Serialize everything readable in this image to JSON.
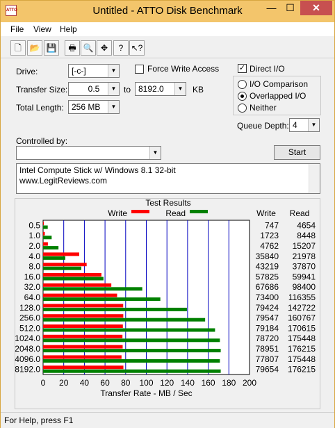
{
  "window": {
    "title": "Untitled - ATTO Disk Benchmark",
    "app_icon_text": "ATTO",
    "min_glyph": "—",
    "max_glyph": "☐",
    "close_glyph": "✕"
  },
  "menu": {
    "file": "File",
    "view": "View",
    "help": "Help"
  },
  "toolbar": {
    "buttons": [
      "new-icon",
      "open-icon",
      "save-icon",
      "print-icon",
      "print-preview-icon",
      "move-icon",
      "help-icon",
      "context-help-icon"
    ]
  },
  "settings": {
    "drive_label": "Drive:",
    "drive_value": "[-c-]",
    "force_write_label": "Force Write Access",
    "direct_io_label": "Direct I/O",
    "direct_io_checked": true,
    "transfer_size_label": "Transfer Size:",
    "transfer_from": "0.5",
    "to_label": "to",
    "transfer_to": "8192.0",
    "kb_label": "KB",
    "total_length_label": "Total Length:",
    "total_length_value": "256 MB",
    "io_comparison_label": "I/O Comparison",
    "overlapped_io_label": "Overlapped I/O",
    "neither_label": "Neither",
    "selected_mode": "overlapped",
    "queue_depth_label": "Queue Depth:",
    "queue_depth_value": "4",
    "controlled_by_label": "Controlled by:",
    "controlled_by_value": "",
    "start_label": "Start",
    "description_line1": "Intel Compute Stick w/ Windows 8.1 32-bit",
    "description_line2": "www.LegitReviews.com"
  },
  "results": {
    "title": "Test Results",
    "write_legend": "Write",
    "read_legend": "Read",
    "write_col": "Write",
    "read_col": "Read",
    "write_color": "#ff0000",
    "read_color": "#008000"
  },
  "status": {
    "text": "For Help, press F1"
  },
  "chart_data": {
    "type": "bar",
    "orientation": "horizontal",
    "title": "Test Results",
    "xlabel": "Transfer Rate - MB / Sec",
    "xlim": [
      0,
      200
    ],
    "xticks": [
      0,
      20,
      40,
      60,
      80,
      100,
      120,
      140,
      160,
      180,
      200
    ],
    "categories": [
      "0.5",
      "1.0",
      "2.0",
      "4.0",
      "8.0",
      "16.0",
      "32.0",
      "64.0",
      "128.0",
      "256.0",
      "512.0",
      "1024.0",
      "2048.0",
      "4096.0",
      "8192.0"
    ],
    "series": [
      {
        "name": "Write",
        "color": "#ff0000",
        "values": [
          0.73,
          1.68,
          4.65,
          35.0,
          42.2,
          56.5,
          66.1,
          71.7,
          77.6,
          77.7,
          77.3,
          76.9,
          77.1,
          76.0,
          77.8
        ],
        "labels": [
          "747",
          "1723",
          "4762",
          "35840",
          "43219",
          "57825",
          "67686",
          "73400",
          "79424",
          "79547",
          "79184",
          "78720",
          "78951",
          "77807",
          "79654"
        ]
      },
      {
        "name": "Read",
        "color": "#008000",
        "values": [
          4.5,
          8.3,
          14.9,
          21.5,
          37.0,
          58.5,
          96.1,
          113.6,
          139.4,
          157.0,
          166.6,
          171.3,
          172.1,
          171.3,
          172.1
        ],
        "labels": [
          "4654",
          "8448",
          "15207",
          "21978",
          "37870",
          "59941",
          "98400",
          "116355",
          "142722",
          "160767",
          "170615",
          "175448",
          "176215",
          "175448",
          "176215"
        ]
      }
    ]
  }
}
